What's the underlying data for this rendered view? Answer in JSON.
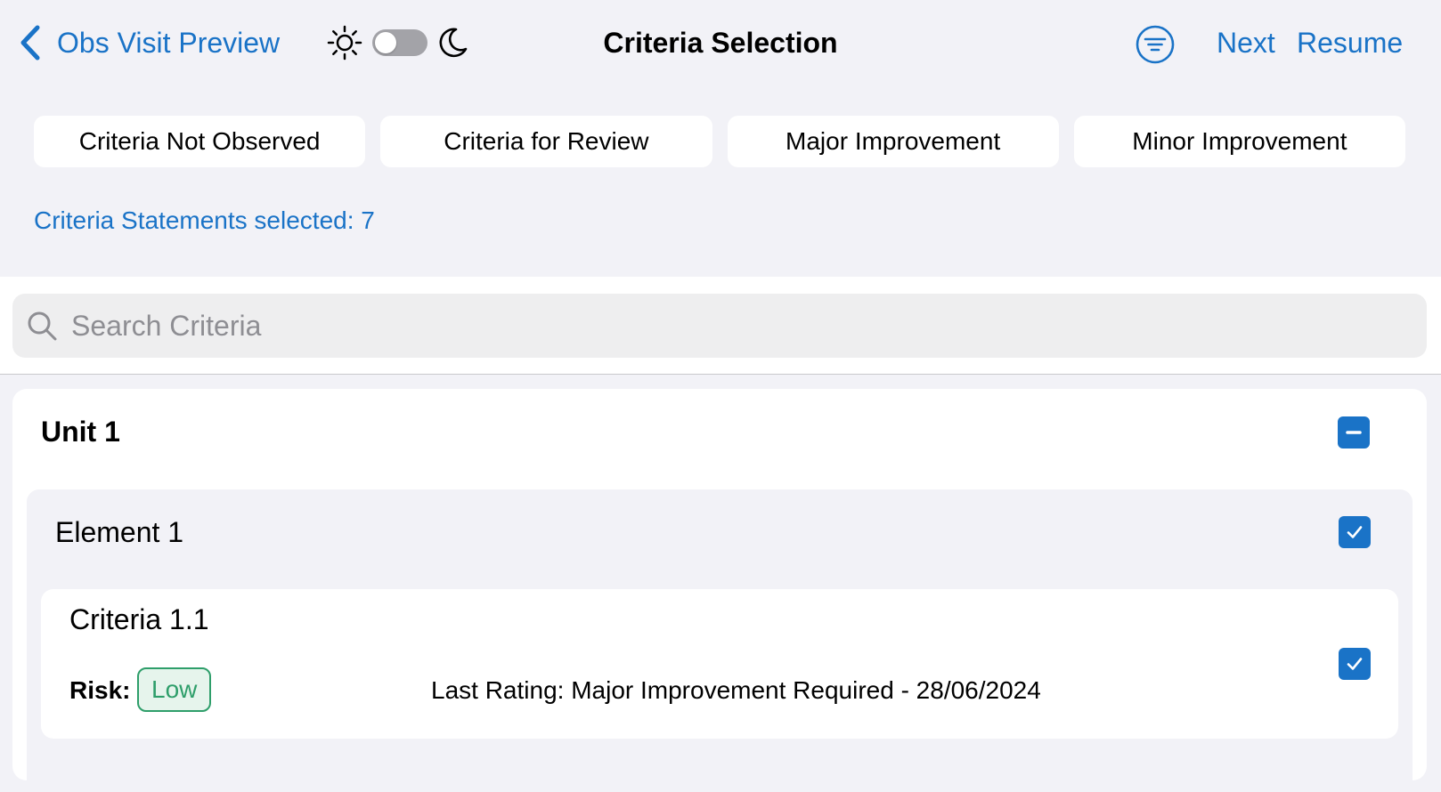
{
  "nav": {
    "back_label": "Obs Visit Preview",
    "title": "Criteria Selection",
    "next_label": "Next",
    "resume_label": "Resume",
    "theme_toggle_on": false
  },
  "segments": [
    {
      "label": "Criteria Not Observed"
    },
    {
      "label": "Criteria for Review"
    },
    {
      "label": "Major Improvement"
    },
    {
      "label": "Minor Improvement"
    }
  ],
  "selection": {
    "count_text": "Criteria Statements selected: 7"
  },
  "search": {
    "placeholder": "Search Criteria",
    "value": ""
  },
  "unit": {
    "title": "Unit 1",
    "checkbox_state": "indeterminate",
    "element": {
      "title": "Element 1",
      "checkbox_state": "checked",
      "criteria": {
        "title": "Criteria 1.1",
        "risk_label": "Risk:",
        "risk_value": "Low",
        "last_rating": "Last Rating: Major Improvement Required - 28/06/2024",
        "checkbox_state": "checked"
      }
    }
  },
  "colors": {
    "accent": "#1a73c7",
    "background": "#f2f2f7",
    "risk_low": "#2e9e6a"
  },
  "icons": {
    "back": "chevron-left-icon",
    "light": "sun-icon",
    "dark": "moon-icon",
    "filter": "filter-lines-icon",
    "search": "magnifier-icon"
  }
}
